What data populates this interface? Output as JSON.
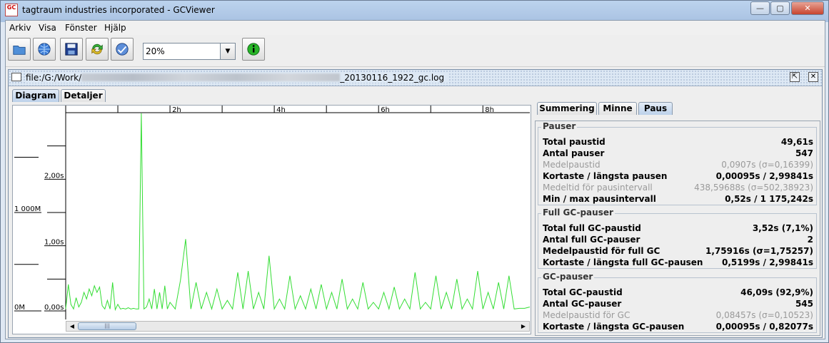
{
  "window": {
    "title": "tagtraum industries incorporated - GCViewer",
    "app_icon_text": "GC",
    "minimize": "—",
    "maximize": "▢",
    "close": "✕"
  },
  "menu": [
    "Arkiv",
    "Visa",
    "Fönster",
    "Hjälp"
  ],
  "toolbar": {
    "zoom_value": "20%",
    "icons": [
      "open-file-icon",
      "open-url-icon",
      "save-icon",
      "refresh-icon",
      "watch-icon",
      "info-icon"
    ]
  },
  "document": {
    "path_prefix": "file:/G:/Work/",
    "path_suffix": "_20130116_1922_gc.log",
    "restore_glyph": "⇱",
    "close_glyph": "✕"
  },
  "view_tabs": [
    "Diagram",
    "Detaljer"
  ],
  "chart_data": {
    "type": "line",
    "x_ticks": [
      "2h",
      "4h",
      "6h",
      "8h"
    ],
    "y_left_labels": [
      "1 000M",
      "0M"
    ],
    "y_right_labels": [
      "2,00s",
      "1,00s",
      "0,00s"
    ],
    "series_color": "#33dd33",
    "x_unit": "h",
    "y_unit": "s",
    "xlim": [
      0,
      8.9
    ],
    "ylim": [
      0,
      3.0
    ],
    "x": [
      0,
      0.05,
      0.1,
      0.15,
      0.2,
      0.25,
      0.3,
      0.35,
      0.4,
      0.45,
      0.5,
      0.55,
      0.6,
      0.65,
      0.7,
      0.75,
      0.8,
      0.85,
      0.9,
      0.95,
      1.0,
      1.05,
      1.1,
      1.15,
      1.2,
      1.25,
      1.3,
      1.35,
      1.4,
      1.45,
      1.5,
      1.55,
      1.6,
      1.65,
      1.7,
      1.75,
      1.8,
      1.85,
      1.9,
      1.95,
      2.0,
      2.1,
      2.2,
      2.3,
      2.4,
      2.5,
      2.6,
      2.7,
      2.8,
      2.9,
      3.0,
      3.1,
      3.2,
      3.3,
      3.4,
      3.5,
      3.6,
      3.7,
      3.8,
      3.9,
      4.0,
      4.1,
      4.2,
      4.3,
      4.4,
      4.5,
      4.6,
      4.7,
      4.8,
      4.9,
      5.0,
      5.1,
      5.2,
      5.3,
      5.4,
      5.5,
      5.6,
      5.7,
      5.8,
      5.9,
      6.0,
      6.1,
      6.2,
      6.3,
      6.4,
      6.5,
      6.6,
      6.7,
      6.8,
      6.9,
      7.0,
      7.1,
      7.2,
      7.3,
      7.4,
      7.5,
      7.6,
      7.7,
      7.8,
      7.9,
      8.0,
      8.1,
      8.2,
      8.3,
      8.4,
      8.5,
      8.6,
      8.7,
      8.8,
      8.9
    ],
    "y": [
      0.05,
      0.42,
      0.12,
      0.05,
      0.22,
      0.08,
      0.15,
      0.3,
      0.2,
      0.35,
      0.25,
      0.4,
      0.3,
      0.38,
      0.1,
      0.05,
      0.18,
      0.05,
      0.45,
      0.04,
      0.12,
      0.05,
      0.06,
      0.05,
      0.07,
      0.05,
      0.06,
      0.05,
      0.05,
      2.99,
      0.05,
      0.08,
      0.2,
      0.05,
      0.35,
      0.05,
      0.3,
      0.05,
      0.4,
      0.05,
      0.15,
      0.05,
      0.48,
      1.1,
      0.05,
      0.45,
      0.05,
      0.3,
      0.05,
      0.35,
      0.05,
      0.18,
      0.05,
      0.6,
      0.05,
      0.62,
      0.05,
      0.3,
      0.05,
      0.85,
      0.05,
      0.2,
      0.05,
      0.55,
      0.05,
      0.25,
      0.05,
      0.35,
      0.05,
      0.42,
      0.05,
      0.3,
      0.05,
      0.5,
      0.05,
      0.2,
      0.05,
      0.45,
      0.05,
      0.15,
      0.05,
      0.3,
      0.05,
      0.38,
      0.05,
      0.2,
      0.05,
      0.6,
      0.05,
      0.15,
      0.05,
      0.55,
      0.05,
      0.3,
      0.05,
      0.5,
      0.05,
      0.2,
      0.05,
      0.62,
      0.05,
      0.3,
      0.05,
      0.45,
      0.05,
      0.55,
      0.05,
      0.06,
      0.06,
      0.08
    ]
  },
  "stat_tabs": [
    "Summering",
    "Minne",
    "Paus"
  ],
  "groups": [
    {
      "title": "Pauser",
      "rows": [
        {
          "label": "Total paustid",
          "value": "49,61s",
          "dim": false
        },
        {
          "label": "Antal pauser",
          "value": "547",
          "dim": false
        },
        {
          "label": "Medelpaustid",
          "value": "0,0907s (σ=0,16399)",
          "dim": true
        },
        {
          "label": "Kortaste / längsta pausen",
          "value": "0,00095s / 2,99841s",
          "dim": false
        },
        {
          "label": "Medeltid för pausintervall",
          "value": "438,59688s (σ=502,38923)",
          "dim": true
        },
        {
          "label": "Min / max pausintervall",
          "value": "0,52s / 1 175,242s",
          "dim": false
        }
      ]
    },
    {
      "title": "Full GC-pauser",
      "rows": [
        {
          "label": "Total full GC-paustid",
          "value": "3,52s (7,1%)",
          "dim": false
        },
        {
          "label": "Antal full GC-pauser",
          "value": "2",
          "dim": false
        },
        {
          "label": "Medelpaustid för full GC",
          "value": "1,75916s (σ=1,75257)",
          "dim": false
        },
        {
          "label": "Kortaste / längsta full GC-pausen",
          "value": "0,5199s / 2,99841s",
          "dim": false
        }
      ]
    },
    {
      "title": "GC-pauser",
      "rows": [
        {
          "label": "Total GC-paustid",
          "value": "46,09s (92,9%)",
          "dim": false
        },
        {
          "label": "Antal GC-pauser",
          "value": "545",
          "dim": false
        },
        {
          "label": "Medelpaustid för GC",
          "value": "0,08457s (σ=0,10523)",
          "dim": true
        },
        {
          "label": "Kortaste / längsta GC-pausen",
          "value": "0,00095s / 0,82077s",
          "dim": false
        }
      ]
    }
  ]
}
